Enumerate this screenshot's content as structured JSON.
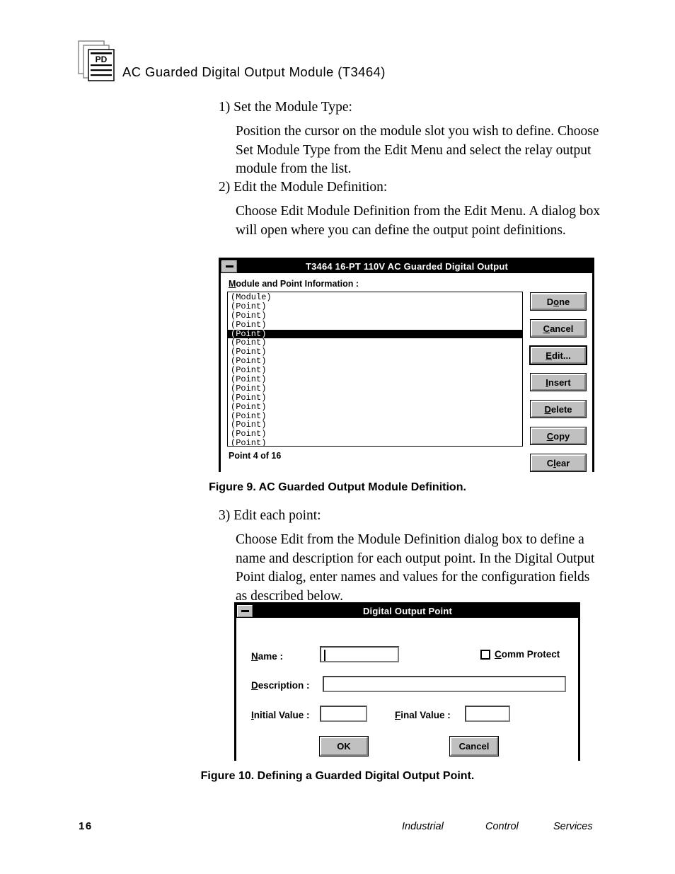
{
  "header": {
    "icon_name": "PD",
    "title": "AC  Guarded  Digital  Output  Module (T3464)"
  },
  "steps": [
    {
      "number": "1) Set the Module Type:",
      "body": "Position the cursor on the module slot you wish to define. Choose Set Module Type from the Edit Menu and select the relay output module from the list."
    },
    {
      "number": "2) Edit the Module Definition:",
      "body": "Choose Edit Module Definition from the Edit Menu.  A dialog box will open where you can define the output point definitions."
    },
    {
      "number": "3) Edit each point:",
      "body": "Choose Edit from the Module Definition dialog box to define a name and description for each output point.  In the Digital Output Point dialog, enter names and values for the configuration fields as described below."
    }
  ],
  "figure9": {
    "dialog": {
      "title": "T3464 16-PT  110V AC Guarded Digital Output",
      "list_label": "Module and Point Information :",
      "list_items": [
        "(Module)",
        "(Point)",
        "(Point)",
        "(Point)",
        "(Point)",
        "(Point)",
        "(Point)",
        "(Point)",
        "(Point)",
        "(Point)",
        "(Point)",
        "(Point)",
        "(Point)",
        "(Point)",
        "(Point)",
        "(Point)",
        "(Point)"
      ],
      "selected_index": 4,
      "status": "Point 4  of 16",
      "buttons": [
        {
          "label": "Done",
          "mnemonic": "o",
          "default": false
        },
        {
          "label": "Cancel",
          "mnemonic": "C",
          "default": false
        },
        {
          "label": "Edit...",
          "mnemonic": "E",
          "default": true
        },
        {
          "label": "Insert",
          "mnemonic": "I",
          "default": false
        },
        {
          "label": "Delete",
          "mnemonic": "D",
          "default": false
        },
        {
          "label": "Copy",
          "mnemonic": "C",
          "default": false
        },
        {
          "label": "Clear",
          "mnemonic": "l",
          "default": false
        }
      ]
    },
    "caption": "Figure 9.  AC Guarded Output Module Definition."
  },
  "figure10": {
    "dialog": {
      "title": "Digital Output Point",
      "fields": {
        "name_label": "Name :",
        "name_value": "",
        "description_label": "Description :",
        "description_value": "",
        "initial_value_label": "Initial Value :",
        "initial_value": "",
        "final_value_label": "Final Value :",
        "final_value": ""
      },
      "checkbox": {
        "label": "Comm Protect",
        "checked": false
      },
      "buttons": [
        {
          "label": "OK"
        },
        {
          "label": "Cancel"
        }
      ]
    },
    "caption": "Figure 10.  Defining a Guarded Digital Output Point."
  },
  "footer": {
    "page_number": "16",
    "words": [
      "Industrial",
      "Control",
      "Services"
    ]
  },
  "colors": {
    "titlebar_bg": "#000000",
    "titlebar_text": "#ffffff",
    "button_face": "#c0c0c0",
    "button_highlight": "#ffffff",
    "button_shadow": "#808080",
    "selection_bg": "#000000",
    "selection_text": "#ffffff",
    "page_bg": "#ffffff",
    "text": "#000000"
  }
}
